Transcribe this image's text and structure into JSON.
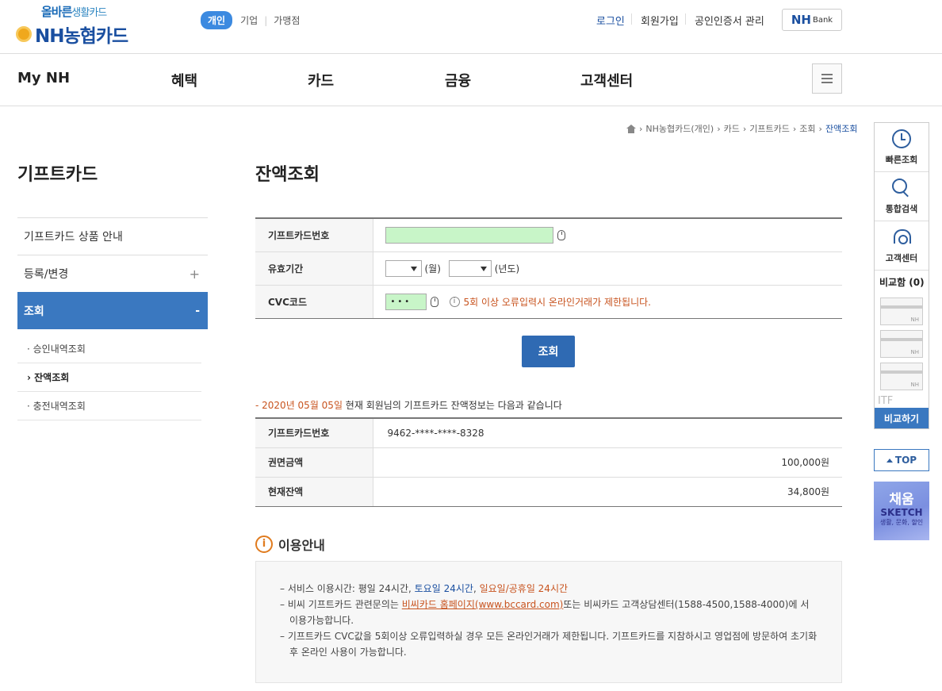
{
  "header": {
    "logo_tagline_blue": "올바른",
    "logo_tagline_rest": "생활카드",
    "logo_name": "NH농협카드",
    "segments": [
      "개인",
      "기업",
      "가맹점"
    ],
    "util_links": [
      "로그인",
      "회원가입",
      "공인인증서 관리"
    ],
    "nhbank_main": "NH",
    "nhbank_sub": "Bank"
  },
  "gnb": [
    "My NH",
    "혜택",
    "카드",
    "금융",
    "고객센터"
  ],
  "breadcrumb": [
    "NH농협카드(개인)",
    "카드",
    "기프트카드",
    "조회",
    "잔액조회"
  ],
  "sidebar": {
    "title": "기프트카드",
    "items": [
      {
        "label": "기프트카드 상품 안내",
        "toggle": ""
      },
      {
        "label": "등록/변경",
        "toggle": "+"
      },
      {
        "label": "조회",
        "toggle": "-"
      }
    ],
    "sub_items": [
      "· 승인내역조회",
      "› 잔액조회",
      "· 충전내역조회"
    ]
  },
  "main": {
    "title": "잔액조회",
    "form": {
      "card_no_label": "기프트카드번호",
      "validity_label": "유효기간",
      "month_unit": "(월)",
      "year_unit": "(년도)",
      "cvc_label": "CVC코드",
      "cvc_value": "•••",
      "cvc_warning": "5회 이상 오류입력시 온라인거래가 제한됩니다."
    },
    "search_button": "조회",
    "result": {
      "caption_prefix": "- ",
      "date": "2020년 05월 05일",
      "caption_suffix": " 현재 회원님의 기프트카드 잔액정보는 다음과 같습니다",
      "rows": [
        {
          "label": "기프트카드번호",
          "value": "9462-****-****-8328"
        },
        {
          "label": "권면금액",
          "value": "100,000원"
        },
        {
          "label": "현재잔액",
          "value": "34,800원"
        }
      ]
    },
    "guide": {
      "title": "이용안내",
      "line1_a": "– 서비스 이용시간: 평일 24시간, ",
      "line1_b": "토요일 24시간",
      "line1_c": ", ",
      "line1_d": "일요일/공휴일 24시간",
      "line2_a": "– 비씨 기프트카드 관련문의는 ",
      "line2_b": "비씨카드 홈페이지(www.bccard.com)",
      "line2_c": "또는 비씨카드 고객상담센터(1588-4500,1588-4000)에 서 이용가능합니다.",
      "line3": "– 기프트카드 CVC값을 5회이상 오류입력하실 경우 모든 온라인거래가 제한됩니다. 기프트카드를 지참하시고 영업점에 방문하여 초기화 후 온라인 사용이 가능합니다."
    }
  },
  "quickbar": {
    "items": [
      "빠른조회",
      "통합검색",
      "고객센터"
    ],
    "compare_title": "비교함 (0)",
    "slot_label": "NH",
    "itf": "ITF",
    "compare_button": "비교하기",
    "top_button": "TOP",
    "banner_line1": "채움",
    "banner_line2": "SKETCH",
    "banner_line3": "생활, 문화, 할인"
  }
}
